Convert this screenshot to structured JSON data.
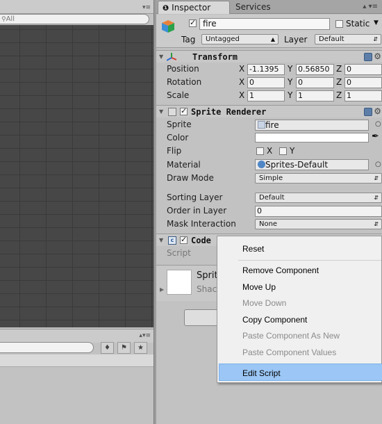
{
  "left_panel": {
    "search_placeholder": "All",
    "menu_glyph": "▾≡",
    "bottom_menu_glyph": "▴▾≡",
    "bottom_icons": [
      "label-icon",
      "tag-icon",
      "star-icon"
    ]
  },
  "tabs": {
    "inspector": "Inspector",
    "services": "Services",
    "inspector_icon": "info-icon",
    "menu_glyph": "▴ ▾≡"
  },
  "game_object": {
    "icon": "cube-icon",
    "active": true,
    "name": "fire",
    "static_label": "Static",
    "tag_label": "Tag",
    "tag_value": "Untagged",
    "layer_label": "Layer",
    "layer_value": "Default"
  },
  "transform": {
    "title": "Transform",
    "rows": [
      {
        "label": "Position",
        "x": "-1.1395",
        "y": "0.56850",
        "z": "0"
      },
      {
        "label": "Rotation",
        "x": "0",
        "y": "0",
        "z": "0"
      },
      {
        "label": "Scale",
        "x": "1",
        "y": "1",
        "z": "1"
      }
    ],
    "axis_x": "X",
    "axis_y": "Y",
    "axis_z": "Z"
  },
  "sprite_renderer": {
    "title": "Sprite Renderer",
    "enabled": true,
    "sprite_label": "Sprite",
    "sprite_value": "fire",
    "color_label": "Color",
    "color_value": "#ffffff",
    "flip_label": "Flip",
    "flip_x": "X",
    "flip_y": "Y",
    "material_label": "Material",
    "material_value": "Sprites-Default",
    "draw_mode_label": "Draw Mode",
    "draw_mode_value": "Simple",
    "sorting_layer_label": "Sorting Layer",
    "sorting_layer_value": "Default",
    "order_label": "Order in Layer",
    "order_value": "0",
    "mask_label": "Mask Interaction",
    "mask_value": "None"
  },
  "code_component": {
    "title_partial": "Code",
    "script_label": "Script",
    "enabled": true
  },
  "material_preview": {
    "name_partial": "Sprit",
    "shader_partial": "Shac"
  },
  "context_menu": {
    "items": [
      {
        "label": "Reset",
        "enabled": true
      },
      {
        "label": "Remove Component",
        "enabled": true
      },
      {
        "label": "Move Up",
        "enabled": true
      },
      {
        "label": "Move Down",
        "enabled": false
      },
      {
        "label": "Copy Component",
        "enabled": true
      },
      {
        "label": "Paste Component As New",
        "enabled": false
      },
      {
        "label": "Paste Component Values",
        "enabled": false
      },
      {
        "label": "Edit Script",
        "enabled": true,
        "highlighted": true
      }
    ]
  },
  "colors": {
    "panel_bg": "#c2c2c2",
    "scene_bg": "#474747",
    "highlight": "#9bc6f5"
  }
}
